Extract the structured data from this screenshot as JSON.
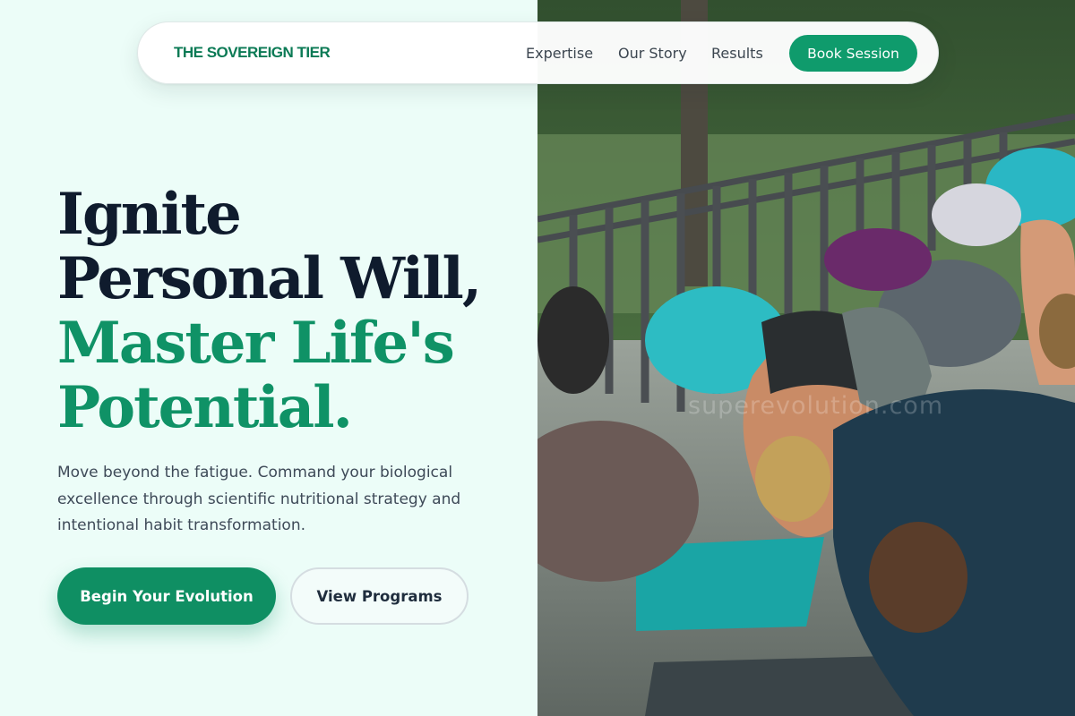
{
  "nav": {
    "brand": "THE SOVEREIGN TIER",
    "links": [
      "Expertise",
      "Our Story",
      "Results"
    ],
    "cta": "Book Session"
  },
  "hero": {
    "headline_dark": [
      "Ignite",
      "Personal Will,"
    ],
    "headline_green": [
      "Master Life's",
      "Potential."
    ],
    "subtext": "Move beyond the fatigue. Command your biological excellence through scientific nutritional strategy and intentional habit transformation.",
    "primary_cta": "Begin Your Evolution",
    "secondary_cta": "View Programs"
  },
  "image": {
    "watermark": "superevolution.com"
  },
  "colors": {
    "accent": "#0f9b6c",
    "brand": "#0b7a55",
    "headline_dark": "#0f1b2d",
    "headline_green": "#0f9266",
    "background": "#ecfdf8"
  }
}
